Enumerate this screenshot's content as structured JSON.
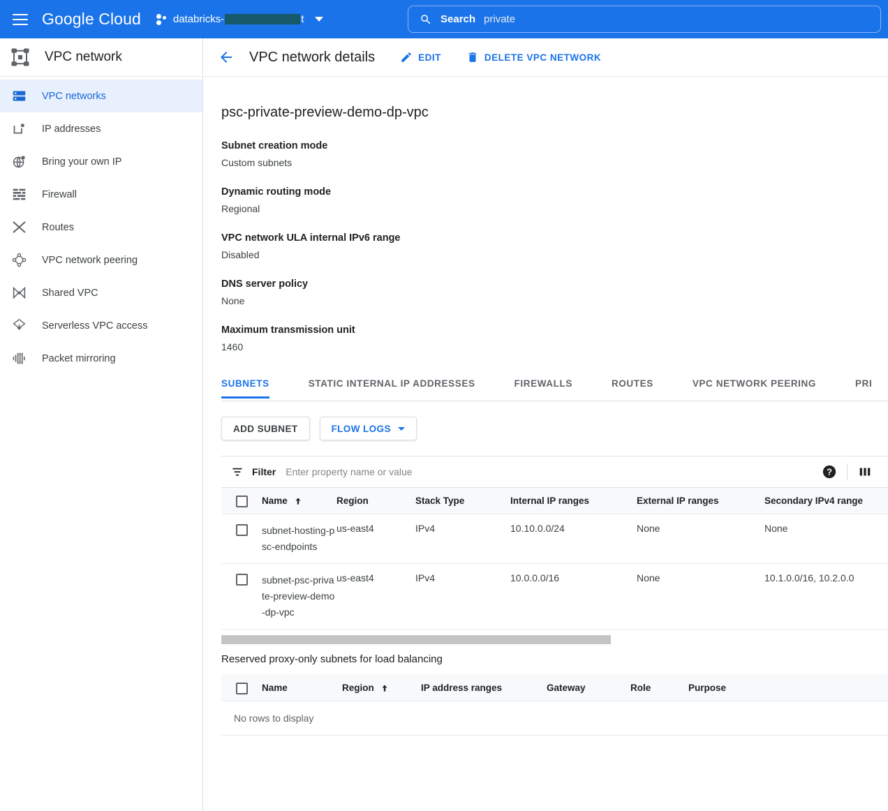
{
  "topbar": {
    "menu_icon": "hamburger-icon",
    "brand": "Google Cloud",
    "project": {
      "prefix": "databricks-",
      "suffix": "t",
      "redacted": true,
      "redaction_color": "#15596b"
    },
    "search": {
      "icon": "search-icon",
      "label": "Search",
      "value": "private",
      "placeholder": "Search"
    },
    "background": "#1a73e8"
  },
  "sidebar": {
    "title": "VPC network",
    "title_icon": "vpc-network-icon",
    "items": [
      {
        "label": "VPC networks",
        "icon": "vpc-networks-icon",
        "active": true
      },
      {
        "label": "IP addresses",
        "icon": "ip-addresses-icon",
        "active": false
      },
      {
        "label": "Bring your own IP",
        "icon": "bring-your-own-ip-icon",
        "active": false
      },
      {
        "label": "Firewall",
        "icon": "firewall-icon",
        "active": false
      },
      {
        "label": "Routes",
        "icon": "routes-icon",
        "active": false
      },
      {
        "label": "VPC network peering",
        "icon": "vpc-network-peering-icon",
        "active": false
      },
      {
        "label": "Shared VPC",
        "icon": "shared-vpc-icon",
        "active": false
      },
      {
        "label": "Serverless VPC access",
        "icon": "serverless-vpc-access-icon",
        "active": false
      },
      {
        "label": "Packet mirroring",
        "icon": "packet-mirroring-icon",
        "active": false
      }
    ],
    "active_color": "#1967d2",
    "active_background": "#e8f0fe"
  },
  "header": {
    "back_icon": "back-arrow-icon",
    "title": "VPC network details",
    "edit_label": "EDIT",
    "edit_icon": "pencil-icon",
    "delete_label": "DELETE VPC NETWORK",
    "delete_icon": "trash-icon",
    "accent_color": "#1a73e8"
  },
  "network": {
    "name": "psc-private-preview-demo-dp-vpc",
    "properties": [
      {
        "label": "Subnet creation mode",
        "value": "Custom subnets"
      },
      {
        "label": "Dynamic routing mode",
        "value": "Regional"
      },
      {
        "label": "VPC network ULA internal IPv6 range",
        "value": "Disabled"
      },
      {
        "label": "DNS server policy",
        "value": "None"
      },
      {
        "label": "Maximum transmission unit",
        "value": "1460"
      }
    ]
  },
  "tabs": [
    {
      "label": "SUBNETS",
      "active": true
    },
    {
      "label": "STATIC INTERNAL IP ADDRESSES",
      "active": false
    },
    {
      "label": "FIREWALLS",
      "active": false
    },
    {
      "label": "ROUTES",
      "active": false
    },
    {
      "label": "VPC NETWORK PEERING",
      "active": false
    },
    {
      "label": "PRI",
      "active": false
    }
  ],
  "toolbar": {
    "add_subnet_label": "ADD SUBNET",
    "flow_logs_label": "FLOW LOGS",
    "flow_logs_caret": "chevron-down-icon"
  },
  "filter": {
    "icon": "filter-icon",
    "label": "Filter",
    "placeholder": "Enter property name or value",
    "value": "",
    "help_icon": "help-icon",
    "columns_icon": "column-display-icon"
  },
  "subnets_table": {
    "columns": [
      {
        "label": "Name",
        "sorted": "asc"
      },
      {
        "label": "Region",
        "sorted": ""
      },
      {
        "label": "Stack Type",
        "sorted": ""
      },
      {
        "label": "Internal IP ranges",
        "sorted": ""
      },
      {
        "label": "External IP ranges",
        "sorted": ""
      },
      {
        "label": "Secondary IPv4 range",
        "sorted": ""
      }
    ],
    "rows": [
      {
        "name": "subnet-hosting-psc-endpoints",
        "region": "us-east4",
        "stack_type": "IPv4",
        "internal_ip_ranges": "10.10.0.0/24",
        "external_ip_ranges": "None",
        "secondary_ipv4_ranges": "None"
      },
      {
        "name": "subnet-psc-private-preview-demo-dp-vpc",
        "region": "us-east4",
        "stack_type": "IPv4",
        "internal_ip_ranges": "10.0.0.0/16",
        "external_ip_ranges": "None",
        "secondary_ipv4_ranges": "10.1.0.0/16, 10.2.0.0"
      }
    ]
  },
  "proxy_table": {
    "title": "Reserved proxy-only subnets for load balancing",
    "columns": [
      {
        "label": "Name",
        "sorted": ""
      },
      {
        "label": "Region",
        "sorted": "asc"
      },
      {
        "label": "IP address ranges",
        "sorted": ""
      },
      {
        "label": "Gateway",
        "sorted": ""
      },
      {
        "label": "Role",
        "sorted": ""
      },
      {
        "label": "Purpose",
        "sorted": ""
      }
    ],
    "empty_message": "No rows to display"
  }
}
